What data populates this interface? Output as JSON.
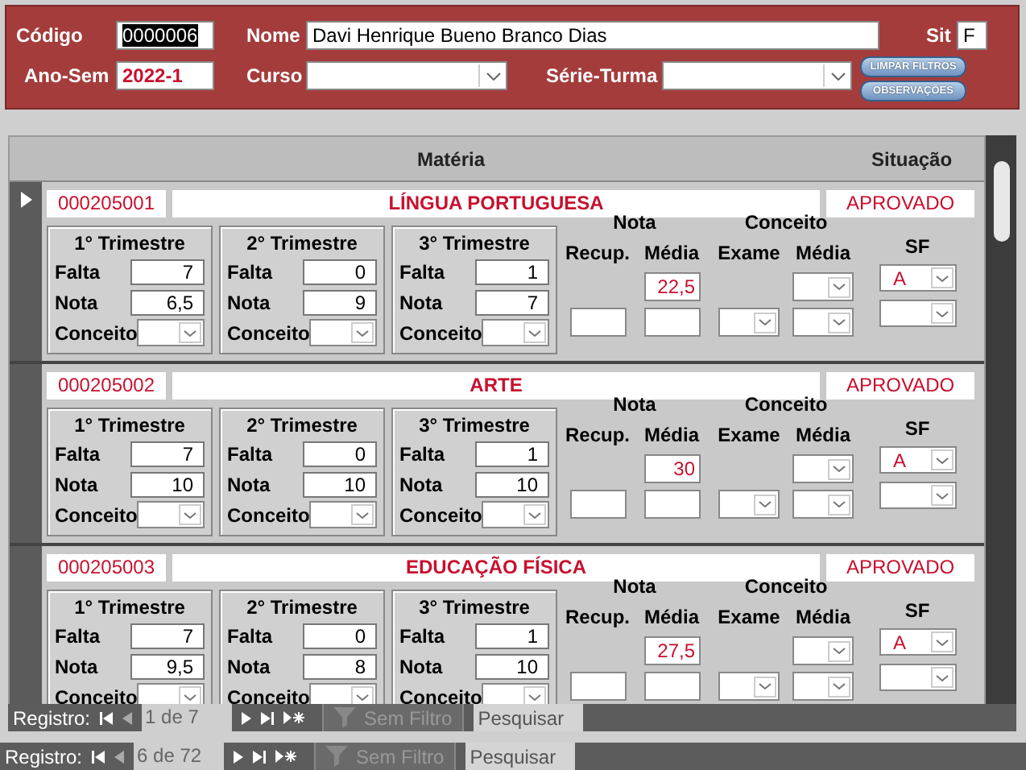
{
  "header": {
    "codigo_label": "Código",
    "codigo": "0000006",
    "nome_label": "Nome",
    "nome": "Davi Henrique Bueno Branco Dias",
    "sit_label": "Sit",
    "sit": "F",
    "ano_sem_label": "Ano-Sem",
    "ano_sem": "2022-1",
    "curso_label": "Curso",
    "serie_label": "Série-Turma",
    "buttons": [
      "LIMPAR FILTROS",
      "OBSERVAÇÕES"
    ]
  },
  "subform": {
    "columns": [
      "Matéria",
      "Situação"
    ],
    "records": [
      {
        "selected": true,
        "codigo": "000205001",
        "materia": "LÍNGUA PORTUGUESA",
        "situacao": "APROVADO",
        "trimestres": [
          {
            "title": "1° Trimestre",
            "falta_label": "Falta",
            "falta": "7",
            "nota_label": "Nota",
            "nota": "6,5",
            "conceito_label": "Conceito"
          },
          {
            "title": "2° Trimestre",
            "falta_label": "Falta",
            "falta": "0",
            "nota_label": "Nota",
            "nota": "9",
            "conceito_label": "Conceito"
          },
          {
            "title": "3° Trimestre",
            "falta_label": "Falta",
            "falta": "1",
            "nota_label": "Nota",
            "nota": "7",
            "conceito_label": "Conceito"
          }
        ],
        "nota": {
          "title": "Nota",
          "recup_label": "Recup.",
          "media_label": "Média",
          "media": "22,5"
        },
        "conceito": {
          "title": "Conceito",
          "exame_label": "Exame",
          "media_label": "Média"
        },
        "sf": {
          "title": "SF",
          "value": "A"
        }
      },
      {
        "selected": false,
        "codigo": "000205002",
        "materia": "ARTE",
        "situacao": "APROVADO",
        "trimestres": [
          {
            "title": "1° Trimestre",
            "falta_label": "Falta",
            "falta": "7",
            "nota_label": "Nota",
            "nota": "10",
            "conceito_label": "Conceito"
          },
          {
            "title": "2° Trimestre",
            "falta_label": "Falta",
            "falta": "0",
            "nota_label": "Nota",
            "nota": "10",
            "conceito_label": "Conceito"
          },
          {
            "title": "3° Trimestre",
            "falta_label": "Falta",
            "falta": "1",
            "nota_label": "Nota",
            "nota": "10",
            "conceito_label": "Conceito"
          }
        ],
        "nota": {
          "title": "Nota",
          "recup_label": "Recup.",
          "media_label": "Média",
          "media": "30"
        },
        "conceito": {
          "title": "Conceito",
          "exame_label": "Exame",
          "media_label": "Média"
        },
        "sf": {
          "title": "SF",
          "value": "A"
        }
      },
      {
        "selected": false,
        "codigo": "000205003",
        "materia": "EDUCAÇÃO FÍSICA",
        "situacao": "APROVADO",
        "trimestres": [
          {
            "title": "1° Trimestre",
            "falta_label": "Falta",
            "falta": "7",
            "nota_label": "Nota",
            "nota": "9,5",
            "conceito_label": "Conceito"
          },
          {
            "title": "2° Trimestre",
            "falta_label": "Falta",
            "falta": "0",
            "nota_label": "Nota",
            "nota": "8",
            "conceito_label": "Conceito"
          },
          {
            "title": "3° Trimestre",
            "falta_label": "Falta",
            "falta": "1",
            "nota_label": "Nota",
            "nota": "10",
            "conceito_label": "Conceito"
          }
        ],
        "nota": {
          "title": "Nota",
          "recup_label": "Recup.",
          "media_label": "Média",
          "media": "27,5"
        },
        "conceito": {
          "title": "Conceito",
          "exame_label": "Exame",
          "media_label": "Média"
        },
        "sf": {
          "title": "SF",
          "value": "A"
        }
      }
    ],
    "nav": {
      "label": "Registro:",
      "position": "1 de 7",
      "filter": "Sem Filtro",
      "search_placeholder": "Pesquisar"
    }
  },
  "nav": {
    "label": "Registro:",
    "position": "6 de 72",
    "filter": "Sem Filtro",
    "search_placeholder": "Pesquisar"
  }
}
